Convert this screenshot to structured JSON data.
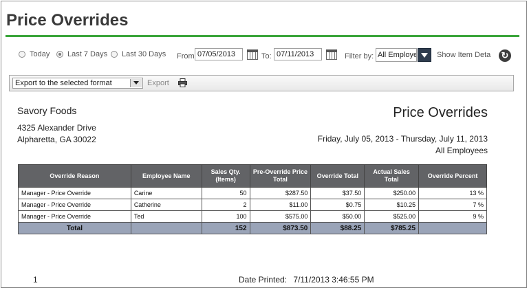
{
  "page": {
    "title": "Price Overrides"
  },
  "filters": {
    "today_label": "Today",
    "last7_label": "Last 7 Days",
    "last30_label": "Last 30 Days",
    "selected_range": "Last 7 Days",
    "from_label": "From:",
    "from_value": "07/05/2013",
    "to_label": "To:",
    "to_value": "07/11/2013",
    "filter_by_label": "Filter by:",
    "filter_value": "All Employe",
    "show_item_label": "Show Item Deta"
  },
  "toolbar": {
    "export_format": "Export to the selected format",
    "export_label": "Export",
    "print_icon": "printer-icon"
  },
  "report": {
    "company": "Savory Foods",
    "address_line1": "4325 Alexander Drive",
    "address_line2": "Alpharetta, GA 30022",
    "title": "Price Overrides",
    "date_range": "Friday, July 05, 2013 - Thursday, July 11, 2013",
    "employee_filter": "All Employees",
    "columns": [
      "Override Reason",
      "Employee Name",
      "Sales Qty. (Items)",
      "Pre-Override Price Total",
      "Override Total",
      "Actual Sales Total",
      "Override Percent"
    ],
    "rows": [
      [
        "Manager - Price Override",
        "Carine",
        "50",
        "$287.50",
        "$37.50",
        "$250.00",
        "13 %"
      ],
      [
        "Manager - Price Override",
        "Catherine",
        "2",
        "$11.00",
        "$0.75",
        "$10.25",
        "7 %"
      ],
      [
        "Manager - Price Override",
        "Ted",
        "100",
        "$575.00",
        "$50.00",
        "$525.00",
        "9 %"
      ]
    ],
    "total": [
      "Total",
      "",
      "152",
      "$873.50",
      "$88.25",
      "$785.25",
      ""
    ]
  },
  "footer": {
    "page_number": "1",
    "date_printed_label": "Date Printed:",
    "date_printed_value": "7/11/2013 3:46:55 PM"
  },
  "colors": {
    "accent_green": "#3aa53a",
    "header_gray": "#626366",
    "total_blue": "#9aa4b8"
  }
}
